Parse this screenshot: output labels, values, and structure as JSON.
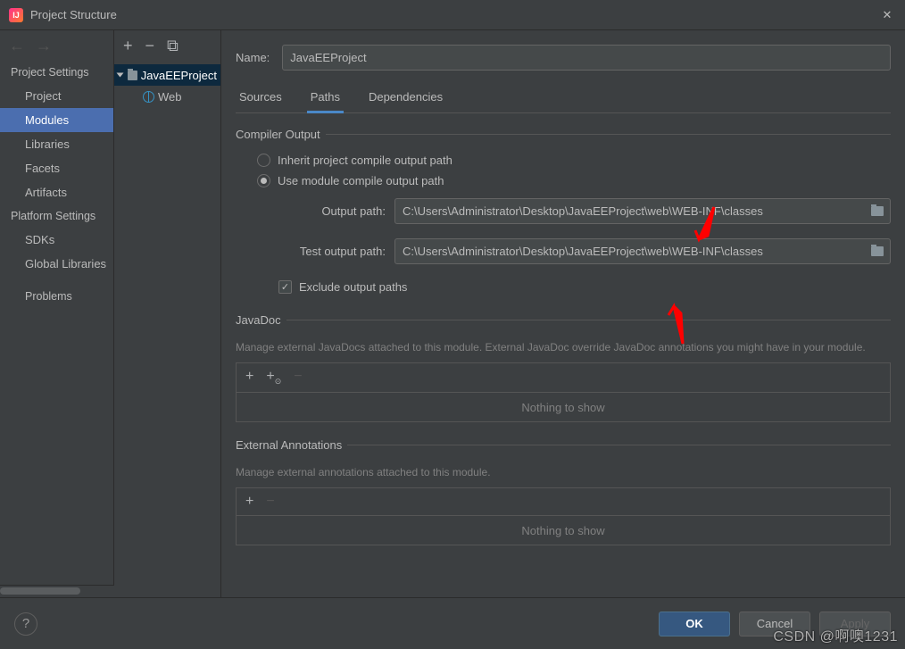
{
  "window": {
    "title": "Project Structure"
  },
  "nav": {
    "heading_settings": "Project Settings",
    "items": [
      "Project",
      "Modules",
      "Libraries",
      "Facets",
      "Artifacts"
    ],
    "heading_platform": "Platform Settings",
    "platform_items": [
      "SDKs",
      "Global Libraries"
    ],
    "problems": "Problems"
  },
  "tree": {
    "root": "JavaEEProject",
    "child": "Web"
  },
  "form": {
    "name_label": "Name:",
    "name_value": "JavaEEProject",
    "tabs": [
      "Sources",
      "Paths",
      "Dependencies"
    ],
    "compiler_heading": "Compiler Output",
    "radio_inherit": "Inherit project compile output path",
    "radio_module": "Use module compile output path",
    "output_label": "Output path:",
    "output_value": "C:\\Users\\Administrator\\Desktop\\JavaEEProject\\web\\WEB-INF\\classes",
    "test_output_label": "Test output path:",
    "test_output_value": "C:\\Users\\Administrator\\Desktop\\JavaEEProject\\web\\WEB-INF\\classes",
    "exclude_label": "Exclude output paths",
    "javadoc_heading": "JavaDoc",
    "javadoc_desc": "Manage external JavaDocs attached to this module. External JavaDoc override JavaDoc annotations you might have in your module.",
    "nothing": "Nothing to show",
    "ext_heading": "External Annotations",
    "ext_desc": "Manage external annotations attached to this module."
  },
  "buttons": {
    "ok": "OK",
    "cancel": "Cancel",
    "apply": "Apply",
    "help": "?"
  },
  "watermark": "CSDN @啊噢1231"
}
